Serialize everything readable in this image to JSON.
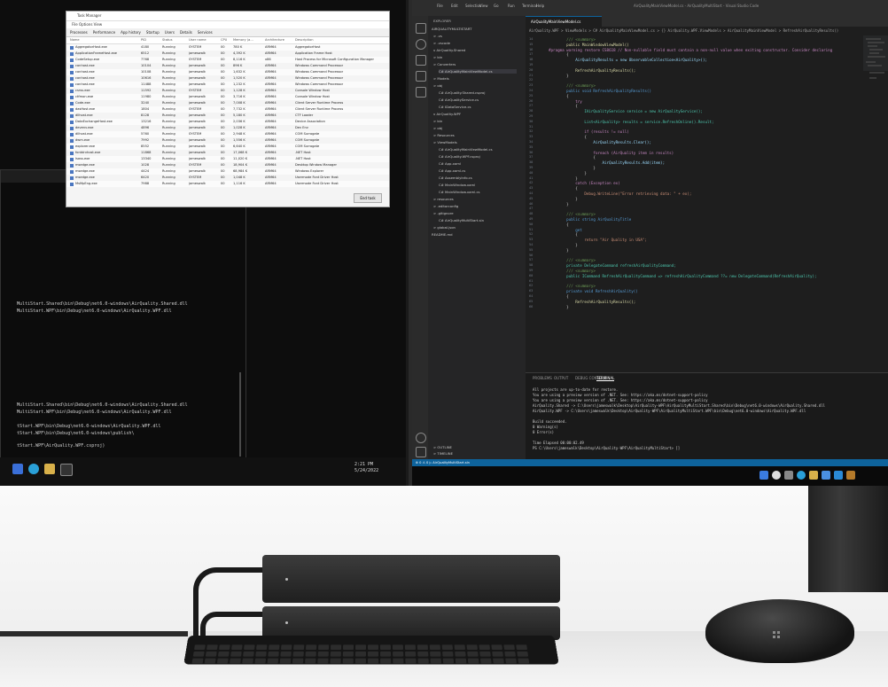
{
  "task_manager": {
    "title": "Task Manager",
    "menu": "File  Options  View",
    "tabs": [
      "Processes",
      "Performance",
      "App history",
      "Startup",
      "Users",
      "Details",
      "Services"
    ],
    "columns": [
      "Name",
      "PID",
      "Status",
      "User name",
      "CPU",
      "Memory (a...",
      "Architecture",
      "Description"
    ],
    "rows": [
      [
        "AggregatorHost.exe",
        "4180",
        "Running",
        "SYSTEM",
        "00",
        "780 K",
        "ARM64",
        "AggregatorHost"
      ],
      [
        "ApplicationFrameHost.exe",
        "6512",
        "Running",
        "jameswalk",
        "00",
        "4,392 K",
        "ARM64",
        "Application Frame Host"
      ],
      [
        "CodeSetup.exe",
        "7768",
        "Running",
        "SYSTEM",
        "00",
        "8,116 K",
        "x86",
        "Host Process for Microsoft Configuration Manager"
      ],
      [
        "conhost.exe",
        "10104",
        "Running",
        "jameswalk",
        "00",
        "896 K",
        "ARM64",
        "Windows Command Processor"
      ],
      [
        "conhost.exe",
        "10108",
        "Running",
        "jameswalk",
        "00",
        "1,632 K",
        "ARM64",
        "Windows Command Processor"
      ],
      [
        "conhost.exe",
        "10616",
        "Running",
        "jameswalk",
        "00",
        "1,520 K",
        "ARM64",
        "Windows Command Processor"
      ],
      [
        "conhost.exe",
        "11488",
        "Running",
        "jameswalk",
        "00",
        "1,232 K",
        "ARM64",
        "Windows Command Processor"
      ],
      [
        "csrss.exe",
        "11592",
        "Running",
        "SYSTEM",
        "00",
        "1,128 K",
        "ARM64",
        "Console Window Host"
      ],
      [
        "ctfmon.exe",
        "11980",
        "Running",
        "jameswalk",
        "00",
        "3,716 K",
        "ARM64",
        "Console Window Host"
      ],
      [
        "Code.exe",
        "3240",
        "Running",
        "jameswalk",
        "00",
        "7,008 K",
        "ARM64",
        "Client Server Runtime Process"
      ],
      [
        "dasHost.exe",
        "1804",
        "Running",
        "SYSTEM",
        "00",
        "7,732 K",
        "ARM64",
        "Client Server Runtime Process"
      ],
      [
        "dllhost.exe",
        "8128",
        "Running",
        "jameswalk",
        "00",
        "5,180 K",
        "ARM64",
        "CTF Loader"
      ],
      [
        "DataExchangeHost.exe",
        "13216",
        "Running",
        "jameswalk",
        "00",
        "2,036 K",
        "ARM64",
        "Device Association"
      ],
      [
        "devenv.exe",
        "4896",
        "Running",
        "jameswalk",
        "00",
        "1,028 K",
        "ARM64",
        "Dev Env"
      ],
      [
        "dllhost.exe",
        "5760",
        "Running",
        "SYSTEM",
        "00",
        "2,948 K",
        "ARM64",
        "COM Surrogate"
      ],
      [
        "dwm.exe",
        "7992",
        "Running",
        "jameswalk",
        "00",
        "1,556 K",
        "ARM64",
        "COM Surrogate"
      ],
      [
        "explorer.exe",
        "8552",
        "Running",
        "jameswalk",
        "00",
        "6,640 K",
        "ARM64",
        "COM Surrogate"
      ],
      [
        "fontdrvhost.exe",
        "11868",
        "Running",
        "jameswalk",
        "00",
        "17,068 K",
        "ARM64",
        ".NET Host"
      ],
      [
        "lsass.exe",
        "13340",
        "Running",
        "jameswalk",
        "00",
        "11,020 K",
        "ARM64",
        ".NET Host"
      ],
      [
        "msedge.exe",
        "1028",
        "Running",
        "SYSTEM",
        "00",
        "18,904 K",
        "ARM64",
        "Desktop Window Manager"
      ],
      [
        "msedge.exe",
        "4424",
        "Running",
        "jameswalk",
        "00",
        "68,984 K",
        "ARM64",
        "Windows Explorer"
      ],
      [
        "msedge.exe",
        "6420",
        "Running",
        "SYSTEM",
        "00",
        "1,048 K",
        "ARM64",
        "Usermode Font Driver Host"
      ],
      [
        "MsMpEng.exe",
        "7988",
        "Running",
        "jameswalk",
        "00",
        "1,116 K",
        "ARM64",
        "Usermode Font Driver Host"
      ]
    ],
    "end_task_label": "End task"
  },
  "terminal": {
    "controls": "—   ☐   ✕",
    "lines": [
      "MultiStart.Shared\\bin\\Debug\\net6.0-windows\\AirQuality.Shared.dll",
      "MultiStart.WPF\\bin\\Debug\\net6.0-windows\\AirQuality.WPF.dll",
      "",
      "MultiStart.Shared\\bin\\Debug\\net6.0-windows\\AirQuality.Shared.dll",
      "MultiStart.WPF\\bin\\Debug\\net6.0-windows\\AirQuality.WPF.dll",
      "",
      "tStart.WPF\\bin\\Debug\\net6.0-windows\\AirQuality.WPF.dll",
      "tStart.WPF\\bin\\Debug\\net6.0-windows\\publish\\",
      "",
      "tStart.WPF\\AirQuality.WPF.csproj)"
    ]
  },
  "left_taskbar": {
    "clock_time": "2:21 PM",
    "clock_date": "5/24/2022",
    "icons": [
      "search-icon",
      "edge-icon",
      "explorer-icon",
      "terminal-icon"
    ]
  },
  "vscode": {
    "menu": [
      "File",
      "Edit",
      "Selection",
      "View",
      "Go",
      "Run",
      "Terminal",
      "Help"
    ],
    "window_title": "AirQualityMainViewModel.cs - AirQualityMultiStart - Visual Studio Code",
    "tab": "AirQualityMainViewModel.cs",
    "breadcrumb": "AirQuality.WPF > ViewModels > C# AirQualityMainViewModel.cs > {} AirQuality.WPF.ViewModels > AirQualityMainViewModel > RefreshAirQualityResults()",
    "explorer_title": "EXPLORER",
    "explorer_items": [
      "AIRQUALITYMULTISTART",
      "> .vs",
      "> .vscode",
      "v AirQuality.Shared",
      "> bin",
      "> Converters",
      "C# AirQualityMainViewModel.cs",
      "> Models",
      "> obj",
      "C# AirQuality.Shared.csproj",
      "C# AirQualityService.cs",
      "C# IDataService.cs",
      "v AirQuality.WPF",
      "> bin",
      "> obj",
      "> Resources",
      "> ViewModels",
      "C# AirQualityMainViewModel.cs",
      "C# AirQuality.WPF.csproj",
      "C# App.xaml",
      "C# App.xaml.cs",
      "C# AssemblyInfo.cs",
      "C# MainWindow.xaml",
      "C# MainWindow.xaml.cs",
      "> resources",
      "> .editorconfig",
      "> .gitignore",
      "C# AirQualityMultiStart.sln",
      "> global.json",
      "README.md"
    ],
    "explorer_footer": [
      "> OUTLINE",
      "> TIMELINE"
    ],
    "code_lines": [
      {
        "n": "14",
        "t": "        /// <summary>",
        "c": "#6a9955"
      },
      {
        "n": "15",
        "t": "        public MainWindowViewModel()",
        "c": "#dcdcaa"
      },
      {
        "n": "16",
        "t": "#pragma warning restore CS8618 // Non-nullable field must contain a non-null value when exiting constructor. Consider declaring",
        "c": "#c586c0"
      },
      {
        "n": "17",
        "t": "        {",
        "c": "#d4d4d4"
      },
      {
        "n": "18",
        "t": "            AirQualityResults = new ObservableCollection<AirQuality>();",
        "c": "#9cdcfe"
      },
      {
        "n": "19",
        "t": "",
        "c": "#d4d4d4"
      },
      {
        "n": "20",
        "t": "            RefreshAirQualityResults();",
        "c": "#dcdcaa"
      },
      {
        "n": "21",
        "t": "        }",
        "c": "#d4d4d4"
      },
      {
        "n": "22",
        "t": "",
        "c": "#d4d4d4"
      },
      {
        "n": "23",
        "t": "        /// <summary>",
        "c": "#6a9955"
      },
      {
        "n": "24",
        "t": "        public void RefreshAirQualityResults()",
        "c": "#569cd6"
      },
      {
        "n": "25",
        "t": "        {",
        "c": "#d4d4d4"
      },
      {
        "n": "26",
        "t": "            try",
        "c": "#c586c0"
      },
      {
        "n": "27",
        "t": "            {",
        "c": "#d4d4d4"
      },
      {
        "n": "28",
        "t": "                IAirQualityService service = new AirQualityService();",
        "c": "#4ec9b0"
      },
      {
        "n": "29",
        "t": "",
        "c": "#d4d4d4"
      },
      {
        "n": "30",
        "t": "                List<AirQuality> results = service.RefreshOnline().Result;",
        "c": "#4ec9b0"
      },
      {
        "n": "31",
        "t": "",
        "c": "#d4d4d4"
      },
      {
        "n": "32",
        "t": "                if (results != null)",
        "c": "#c586c0"
      },
      {
        "n": "33",
        "t": "                {",
        "c": "#d4d4d4"
      },
      {
        "n": "34",
        "t": "                    AirQualityResults.Clear();",
        "c": "#9cdcfe"
      },
      {
        "n": "35",
        "t": "",
        "c": "#d4d4d4"
      },
      {
        "n": "36",
        "t": "                    foreach (AirQuality item in results)",
        "c": "#c586c0"
      },
      {
        "n": "37",
        "t": "                    {",
        "c": "#d4d4d4"
      },
      {
        "n": "38",
        "t": "                        AirQualityResults.Add(item);",
        "c": "#9cdcfe"
      },
      {
        "n": "39",
        "t": "                    }",
        "c": "#d4d4d4"
      },
      {
        "n": "40",
        "t": "                }",
        "c": "#d4d4d4"
      },
      {
        "n": "41",
        "t": "            }",
        "c": "#d4d4d4"
      },
      {
        "n": "42",
        "t": "            catch (Exception ex)",
        "c": "#c586c0"
      },
      {
        "n": "43",
        "t": "            {",
        "c": "#d4d4d4"
      },
      {
        "n": "44",
        "t": "                Debug.WriteLine(\"Error retrieving data: \" + ex);",
        "c": "#ce9178"
      },
      {
        "n": "45",
        "t": "            }",
        "c": "#d4d4d4"
      },
      {
        "n": "46",
        "t": "        }",
        "c": "#d4d4d4"
      },
      {
        "n": "47",
        "t": "",
        "c": "#d4d4d4"
      },
      {
        "n": "48",
        "t": "        /// <summary>",
        "c": "#6a9955"
      },
      {
        "n": "49",
        "t": "        public string AirQualityTitle",
        "c": "#569cd6"
      },
      {
        "n": "50",
        "t": "        {",
        "c": "#d4d4d4"
      },
      {
        "n": "51",
        "t": "            get",
        "c": "#569cd6"
      },
      {
        "n": "52",
        "t": "            {",
        "c": "#d4d4d4"
      },
      {
        "n": "53",
        "t": "                return \"Air Quality in USA\";",
        "c": "#ce9178"
      },
      {
        "n": "54",
        "t": "            }",
        "c": "#d4d4d4"
      },
      {
        "n": "55",
        "t": "        }",
        "c": "#d4d4d4"
      },
      {
        "n": "56",
        "t": "",
        "c": "#d4d4d4"
      },
      {
        "n": "57",
        "t": "        /// <summary>",
        "c": "#6a9955"
      },
      {
        "n": "58",
        "t": "        private DelegateCommand refreshAirQualityCommand;",
        "c": "#4ec9b0"
      },
      {
        "n": "59",
        "t": "        /// <summary>",
        "c": "#6a9955"
      },
      {
        "n": "60",
        "t": "        public ICommand RefreshAirQualityCommand => refreshAirQualityCommand ??= new DelegateCommand(RefreshAirQuality);",
        "c": "#4ec9b0"
      },
      {
        "n": "61",
        "t": "",
        "c": "#d4d4d4"
      },
      {
        "n": "62",
        "t": "        /// <summary>",
        "c": "#6a9955"
      },
      {
        "n": "63",
        "t": "        private void RefreshAirQuality()",
        "c": "#569cd6"
      },
      {
        "n": "64",
        "t": "        {",
        "c": "#d4d4d4"
      },
      {
        "n": "65",
        "t": "            RefreshAirQualityResults();",
        "c": "#dcdcaa"
      },
      {
        "n": "66",
        "t": "        }",
        "c": "#d4d4d4"
      }
    ],
    "panel_tabs": [
      "PROBLEMS",
      "OUTPUT",
      "DEBUG CONSOLE",
      "TERMINAL"
    ],
    "output_lines": [
      "  All projects are up-to-date for restore.",
      "  You are using a preview version of .NET. See: https://aka.ms/dotnet-support-policy",
      "  You are using a preview version of .NET. See: https://aka.ms/dotnet-support-policy",
      "  AirQuality.Shared -> C:\\Users\\jameswalk\\Desktop\\AirQuality-WPF\\AirQualityMultiStart.Shared\\bin\\Debug\\net6.0-windows\\AirQuality.Shared.dll",
      "  AirQuality.WPF -> C:\\Users\\jameswalk\\Desktop\\AirQuality-WPF\\AirQualityMultiStart.WPF\\bin\\Debug\\net6.0-windows\\AirQuality.WPF.dll",
      "",
      "Build succeeded.",
      "    0 Warning(s)",
      "    0 Error(s)",
      "",
      "Time Elapsed 00:00:02.49",
      "PS C:\\Users\\jameswalk\\Desktop\\AirQuality-WPF\\AirQualityMultiStart> []"
    ],
    "status_bar": "⊗ 0 ⚠ 0   ▷ AirQualityMultiStart.sln",
    "taskbar_icons": [
      "windows-icon",
      "search-icon",
      "taskview-icon",
      "edge-icon",
      "explorer-icon",
      "store-icon",
      "vscode-icon",
      "settings-icon"
    ]
  },
  "colors": {
    "vscode_accent": "#0e639c",
    "editor_bg": "#1e1e1e",
    "taskmgr_bg": "#f4f4f4"
  }
}
